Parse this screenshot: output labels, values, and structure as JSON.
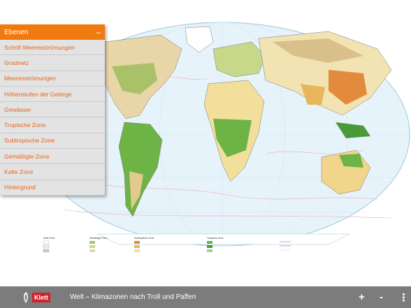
{
  "panel": {
    "header": "Ebenen",
    "collapse_symbol": "–",
    "items": [
      {
        "label": "Schrift Meeresströmungen"
      },
      {
        "label": "Gradnetz"
      },
      {
        "label": "Meeresströmungen"
      },
      {
        "label": "Höhenstufen der Gebirge"
      },
      {
        "label": "Gewässer"
      },
      {
        "label": "Tropische Zone"
      },
      {
        "label": "Subtropische Zone"
      },
      {
        "label": "Gemäßigte Zone"
      },
      {
        "label": "Kalte Zone"
      },
      {
        "label": "Hintergrund"
      }
    ]
  },
  "legend": {
    "groups": [
      {
        "title": "Kalte Zone"
      },
      {
        "title": "Gemäßigte Zone"
      },
      {
        "title": "Subtropische Zone"
      },
      {
        "title": "Tropische Zone"
      }
    ]
  },
  "footer": {
    "brand": "Klett",
    "title": "Welt – Klimazonen nach Troll und Paffen",
    "zoom_in": "+",
    "zoom_out": "-",
    "menu": "⋮"
  },
  "colors": {
    "accent": "#f07a10",
    "footer_bg": "#7c7c7c",
    "brand_red": "#d2232a"
  }
}
